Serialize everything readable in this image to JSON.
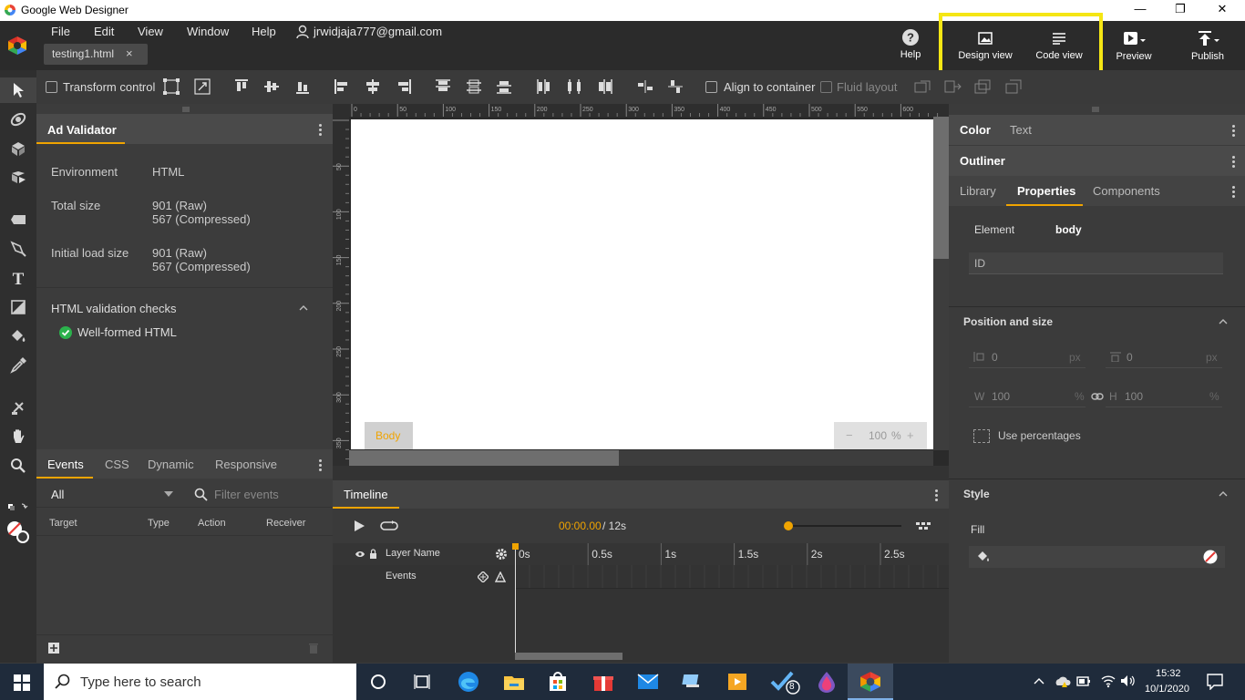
{
  "window": {
    "title": "Google Web Designer",
    "minimize": "—",
    "maximize": "❐",
    "close": "✕"
  },
  "menu": {
    "file": "File",
    "edit": "Edit",
    "view": "View",
    "window": "Window",
    "help": "Help",
    "user": "jrwidjaja777@gmail.com"
  },
  "doc_tab": {
    "name": "testing1.html",
    "close": "×"
  },
  "top_buttons": {
    "help": "Help",
    "design_view": "Design view",
    "code_view": "Code view",
    "preview": "Preview",
    "publish": "Publish"
  },
  "highlight_color": "#f5e614",
  "accent": "#f0a400",
  "toolbar": {
    "transform_control": "Transform control",
    "align_to_container": "Align to container",
    "fluid_layout": "Fluid layout"
  },
  "ad_validator": {
    "title": "Ad Validator",
    "rows": [
      {
        "label": "Environment",
        "value1": "HTML",
        "value2": ""
      },
      {
        "label": "Total size",
        "value1": "901 (Raw)",
        "value2": "567 (Compressed)"
      },
      {
        "label": "Initial load size",
        "value1": "901 (Raw)",
        "value2": "567 (Compressed)"
      }
    ],
    "checks_title": "HTML validation checks",
    "check_item": "Well-formed HTML"
  },
  "events_panel": {
    "tabs": [
      "Events",
      "CSS",
      "Dynamic",
      "Responsive"
    ],
    "filter_value": "All",
    "filter_placeholder": "Filter events",
    "columns": [
      "Target",
      "Type",
      "Action",
      "Receiver"
    ]
  },
  "stage": {
    "ruler_top": [
      "0",
      "50",
      "100",
      "150",
      "200",
      "250",
      "300",
      "350",
      "400",
      "450",
      "500",
      "550",
      "600"
    ],
    "ruler_left": [
      "50",
      "100",
      "150",
      "200",
      "250",
      "300",
      "350"
    ],
    "breadcrumb": "Body",
    "zoom": {
      "minus": "−",
      "value": "100",
      "unit": "%",
      "plus": "+"
    }
  },
  "timeline": {
    "title": "Timeline",
    "time_current": "00:00.00",
    "time_total": " / 12s",
    "layer_header": "Layer Name",
    "events_row": "Events",
    "ticks": [
      "0s",
      "0.5s",
      "1s",
      "1.5s",
      "2s",
      "2.5s"
    ]
  },
  "right_panel": {
    "tabs_top": [
      "Color",
      "Text"
    ],
    "outliner": "Outliner",
    "tabs": [
      "Library",
      "Properties",
      "Components"
    ],
    "element_label": "Element",
    "element_value": "body",
    "id_placeholder": "ID",
    "position_size": "Position and size",
    "x_value": "0",
    "y_value": "0",
    "px": "px",
    "w_label": "W",
    "w_value": "100",
    "h_label": "H",
    "h_value": "100",
    "pct": "%",
    "use_percentages": "Use percentages",
    "style": "Style",
    "fill": "Fill"
  },
  "taskbar": {
    "search_placeholder": "Type here to search",
    "time": "15:32",
    "date": "10/1/2020",
    "badge": "8"
  }
}
